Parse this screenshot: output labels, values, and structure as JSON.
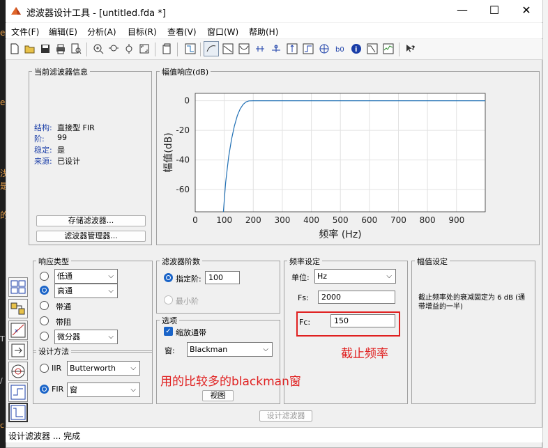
{
  "window": {
    "title": "滤波器设计工具 - [untitled.fda *]",
    "controls": {
      "minimize": "—",
      "maximize": "☐",
      "close": "✕"
    }
  },
  "menu": [
    "文件(F)",
    "编辑(E)",
    "分析(A)",
    "目标(R)",
    "查看(V)",
    "窗口(W)",
    "帮助(H)"
  ],
  "info_panel": {
    "title": "当前滤波器信息",
    "rows": [
      {
        "label": "结构:",
        "value": "直接型 FIR"
      },
      {
        "label": "阶:",
        "value": "99"
      },
      {
        "label": "稳定:",
        "value": "是"
      },
      {
        "label": "来源:",
        "value": "已设计"
      }
    ],
    "store_button": "存储滤波器...",
    "manager_button": "滤波器管理器..."
  },
  "mag_panel": {
    "title": "幅值响应(dB)"
  },
  "chart_data": {
    "type": "line",
    "xlabel": "频率 (Hz)",
    "ylabel": "幅值(dB)",
    "xlim": [
      0,
      999
    ],
    "ylim": [
      -75,
      5
    ],
    "xticks": [
      "0",
      "100",
      "200",
      "300",
      "400",
      "500",
      "600",
      "700",
      "800",
      "900"
    ],
    "yticks": [
      "0",
      "-20",
      "-40",
      "-60"
    ],
    "grid": true,
    "series": [
      {
        "color": "#1f6fb4",
        "x": [
          97,
          105,
          115,
          125,
          135,
          145,
          155,
          165,
          175,
          185,
          200,
          250,
          300,
          400,
          500,
          600,
          700,
          800,
          900,
          999
        ],
        "y": [
          -75,
          -55,
          -38,
          -26,
          -17,
          -10,
          -5.5,
          -2.5,
          -0.8,
          -0.1,
          0,
          0,
          0,
          0,
          0,
          0,
          0,
          0,
          0,
          0
        ]
      }
    ]
  },
  "response_type": {
    "title": "响应类型",
    "options": [
      {
        "label": "低通",
        "selected": false,
        "dropdown": true
      },
      {
        "label": "高通",
        "selected": true,
        "dropdown": true
      },
      {
        "label": "带通",
        "selected": false,
        "dropdown": false
      },
      {
        "label": "带阻",
        "selected": false,
        "dropdown": false
      },
      {
        "label": "微分器",
        "selected": false,
        "dropdown": true
      }
    ]
  },
  "design_method": {
    "title": "设计方法",
    "iir": {
      "label": "IIR",
      "selected": false,
      "value": "Butterworth"
    },
    "fir": {
      "label": "FIR",
      "selected": true,
      "value": "窗"
    }
  },
  "order_panel": {
    "title": "滤波器阶数",
    "specify": {
      "label": "指定阶:",
      "selected": true,
      "value": "100"
    },
    "minimum": {
      "label": "最小阶",
      "selected": false
    }
  },
  "options_panel": {
    "title": "选项",
    "scale_passband": {
      "label": "缩放通带",
      "checked": true
    },
    "window_label": "窗:",
    "window_value": "Blackman",
    "view_button": "视图"
  },
  "freq_panel": {
    "title": "频率设定",
    "units_label": "单位:",
    "units_value": "Hz",
    "fs_label": "Fs:",
    "fs_value": "2000",
    "fc_label": "Fc:",
    "fc_value": "150"
  },
  "magspec_panel": {
    "title": "幅值设定",
    "text": "截止频率处的衰减固定为 6 dB (通带增益的一半)"
  },
  "annotations": {
    "cutoff": "截止频率",
    "window_note": "用的比较多的blackman窗",
    "color": "#e02020"
  },
  "design_button": "设计滤波器",
  "status": "设计滤波器 ... 完成",
  "background_fragments": [
    "e",
    "e",
    "浅",
    "是",
    "的",
    "T",
    "/",
    "c",
    "c"
  ]
}
